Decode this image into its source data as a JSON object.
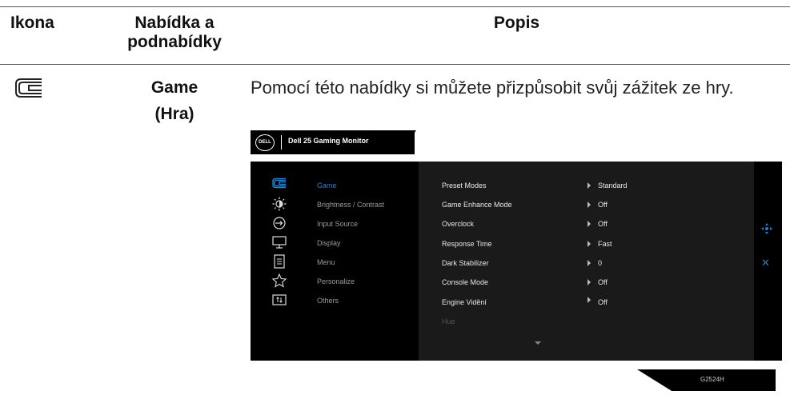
{
  "table": {
    "headers": {
      "icon": "Ikona",
      "menu_line1": "Nabídka a",
      "menu_line2": "podnabídky",
      "description": "Popis"
    },
    "row": {
      "icon_name": "game-icon",
      "menu_name_line1": "Game",
      "menu_name_line2": "(Hra)",
      "description": "Pomocí této nabídky si můžete přizpůsobit svůj zážitek ze hry."
    }
  },
  "osd": {
    "logo": "DELL",
    "title": "Dell 25 Gaming Monitor",
    "accent_color": "#1e7fd0",
    "left_menu": [
      {
        "label": "Game",
        "icon": "game-icon",
        "selected": true
      },
      {
        "label": "Brightness / Contrast",
        "icon": "brightness-icon"
      },
      {
        "label": "Input Source",
        "icon": "input-source-icon"
      },
      {
        "label": "Display",
        "icon": "display-icon"
      },
      {
        "label": "Menu",
        "icon": "menu-icon"
      },
      {
        "label": "Personalize",
        "icon": "star-icon"
      },
      {
        "label": "Others",
        "icon": "others-icon"
      }
    ],
    "settings": [
      {
        "name": "Preset Modes",
        "value": "Standard"
      },
      {
        "name": "Game Enhance Mode",
        "value": "Off"
      },
      {
        "name": "Overclock",
        "value": "Off"
      },
      {
        "name": "Response Time",
        "value": "Fast"
      },
      {
        "name": "Dark Stabilizer",
        "value": "0"
      },
      {
        "name": "Console Mode",
        "value": "Off"
      },
      {
        "name": "Engine Vidění",
        "value": "Off"
      },
      {
        "name": "Hue",
        "value": ""
      }
    ],
    "controls": {
      "move_icon": "move-icon",
      "close_icon": "close-icon"
    },
    "model": "G2524H"
  }
}
